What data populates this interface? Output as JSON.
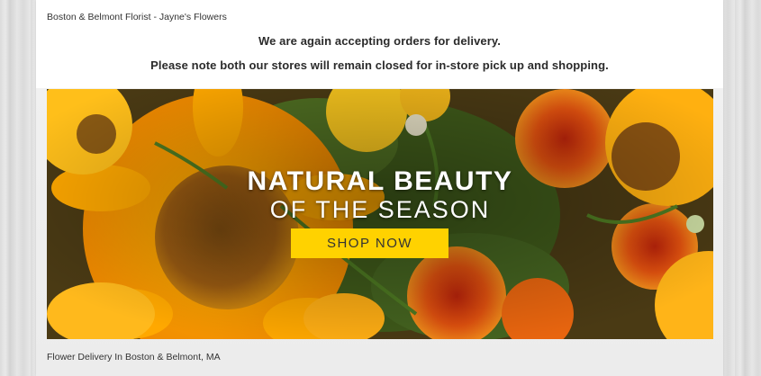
{
  "header": {
    "site_title": "Boston & Belmont Florist - Jayne's Flowers"
  },
  "notices": {
    "line1": "We are again accepting orders for delivery.",
    "line2": "Please note both our stores will remain closed for in-store pick up and shopping."
  },
  "banner": {
    "headline": "NATURAL BEAUTY",
    "subheadline": "OF THE SEASON",
    "cta_label": "SHOP NOW",
    "image": "sunflowers-and-marigolds-bouquet",
    "colors": {
      "cta_background": "#ffd200",
      "text": "#ffffff"
    }
  },
  "footer": {
    "caption": "Flower Delivery In Boston & Belmont, MA"
  }
}
